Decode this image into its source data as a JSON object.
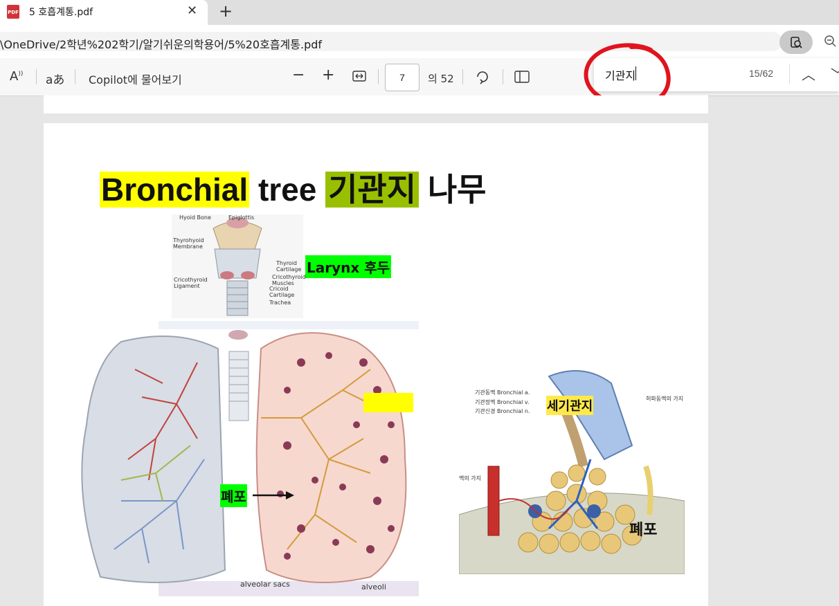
{
  "tab": {
    "title": "5 호흡계통.pdf",
    "icon": "pdf-icon",
    "close_icon": "close-icon",
    "new_tab_icon": "plus-icon"
  },
  "address": {
    "url": "\\OneDrive/2학년%202학기/알기쉬운의학용어/5%20호흡계통.pdf"
  },
  "toolbar": {
    "read_aloud_icon": "read-aloud-icon",
    "translate_label": "aあ",
    "copilot_label": "Copilot에 물어보기",
    "zoom_out_icon": "minus-icon",
    "zoom_in_icon": "plus-icon",
    "fit_icon": "fit-width-icon",
    "page_current": "7",
    "page_total_label": "의 52",
    "rotate_icon": "rotate-icon",
    "view_icon": "page-view-icon"
  },
  "find": {
    "query": "기관지",
    "count": "15/62",
    "prev_icon": "chevron-up-icon",
    "next_icon": "chevron-down-icon"
  },
  "slide": {
    "title_part1": "Bronchial",
    "title_part2": "tree",
    "title_part3": "기관지",
    "title_part4": "나무",
    "label_larynx": "Larynx 후두",
    "label_alveoli_left": "폐포",
    "label_bronchiole": "세기관지",
    "label_alveoli_right": "폐포",
    "small_alveoli": "alveoli",
    "small_alveolar_sacs": "alveolar sacs",
    "larynx_labels": [
      "Hyoid Bone",
      "Epiglottis",
      "Thyrohyoid Membrane",
      "Thyroid Cartilage",
      "Cricothyroid Muscles",
      "Cricothyroid Ligament",
      "Cricoid Cartilage",
      "Trachea"
    ],
    "right_fig_labels": [
      "기관동맥 Bronchial a.",
      "기관정맥 Bronchial v.",
      "기관신경 Bronchial n.",
      "허파동맥의 가지",
      "맥의 가지"
    ]
  },
  "colors": {
    "highlight_yellow": "#ffff00",
    "highlight_current": "#99c000",
    "label_green": "#00ff00",
    "annotation_red": "#e0141e"
  }
}
